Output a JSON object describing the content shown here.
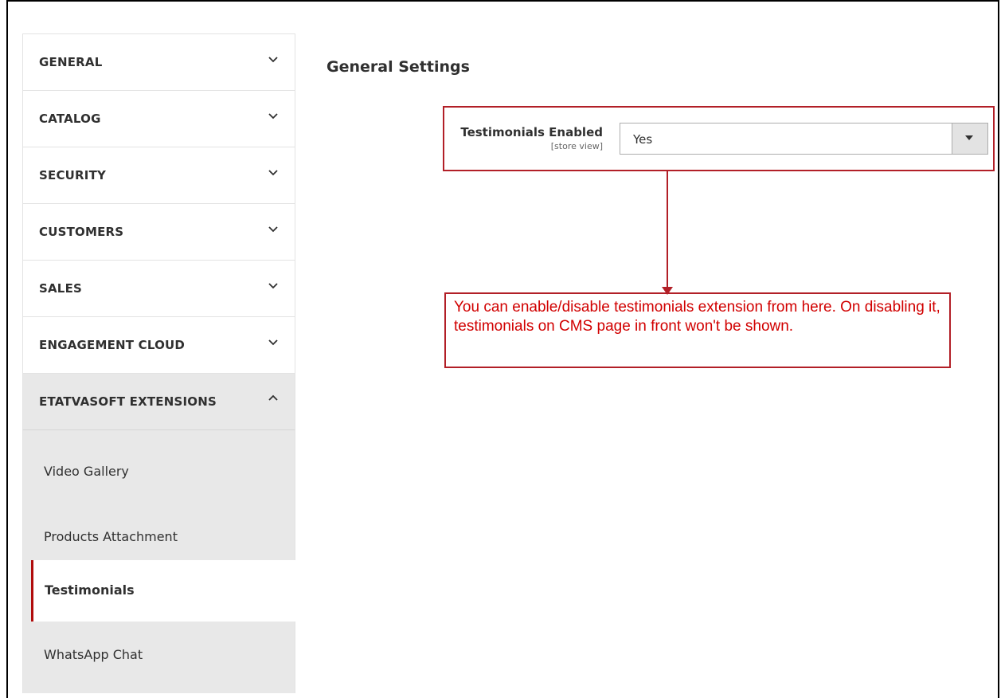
{
  "sidebar": {
    "tabs": [
      {
        "label": "GENERAL"
      },
      {
        "label": "CATALOG"
      },
      {
        "label": "SECURITY"
      },
      {
        "label": "CUSTOMERS"
      },
      {
        "label": "SALES"
      },
      {
        "label": "ENGAGEMENT CLOUD"
      },
      {
        "label": "ETATVASOFT EXTENSIONS"
      }
    ],
    "sub_items": [
      {
        "label": "Video Gallery"
      },
      {
        "label": "Products Attachment"
      },
      {
        "label": "Testimonials"
      },
      {
        "label": "WhatsApp Chat"
      }
    ]
  },
  "main": {
    "title": "General Settings",
    "field": {
      "label": "Testimonials Enabled",
      "scope": "[store view]",
      "value": "Yes"
    },
    "annotation": "You can enable/disable testimonials extension from here. On disabling it, testimonials on CMS page in front won't be shown."
  },
  "colors": {
    "accent": "#b21f27",
    "annotation_text": "#d10000",
    "sidebar_open_bg": "#e8e8e8"
  }
}
